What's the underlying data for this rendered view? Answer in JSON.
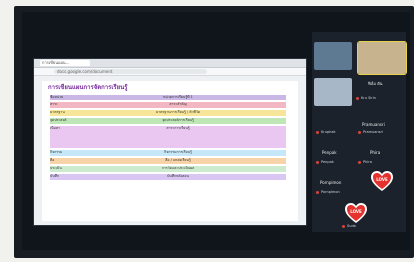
{
  "browser": {
    "tab": "การเขียนแผน...",
    "url": "docs.google.com/document"
  },
  "document": {
    "title": "การเขียนแผนการจัดการเรียนรู้",
    "rows": [
      {
        "label": "ชื่อหน่วย",
        "text": "หน่วยการเรียนรู้ที่ 1",
        "color": "#c9b8e6"
      },
      {
        "label": "สาระ",
        "text": "สาระสำคัญ",
        "color": "#f3b7c3"
      },
      {
        "label": "มาตรฐาน",
        "text": "มาตรฐานการเรียนรู้ / ตัวชี้วัด",
        "color": "#f7e59a"
      },
      {
        "label": "จุดประสงค์",
        "text": "จุดประสงค์การเรียนรู้",
        "color": "#bfe6b6"
      },
      {
        "label": "เนื้อหา",
        "text": "สาระการเรียนรู้",
        "color": "#e9c7f0"
      },
      {
        "label": "กิจกรรม",
        "text": "กิจกรรมการเรียนรู้",
        "color": "#c6e7f7"
      },
      {
        "label": "สื่อ",
        "text": "สื่อ / แหล่งเรียนรู้",
        "color": "#f9d3a8"
      },
      {
        "label": "ประเมิน",
        "text": "การวัดและประเมินผล",
        "color": "#cdeccf"
      },
      {
        "label": "บันทึก",
        "text": "บันทึกหลังสอน",
        "color": "#d9c6f2"
      }
    ]
  },
  "participants": {
    "top_tiles": [
      {
        "name": "",
        "bg": "#5e7a93"
      },
      {
        "name": "",
        "bg": "#c7b48f"
      },
      {
        "name": "",
        "bg": "#a7b7c8"
      }
    ],
    "labels": [
      "ฟิล์ม ตัน",
      "Kru Sirin",
      "Pramuansri",
      "Kruphak",
      "Penpak",
      "Phira",
      "Pornpimon",
      "Suda"
    ],
    "hearts": [
      {
        "text": "LOVE"
      },
      {
        "text": "LOVE"
      }
    ]
  },
  "colors": {
    "accent_red": "#d9433b"
  }
}
